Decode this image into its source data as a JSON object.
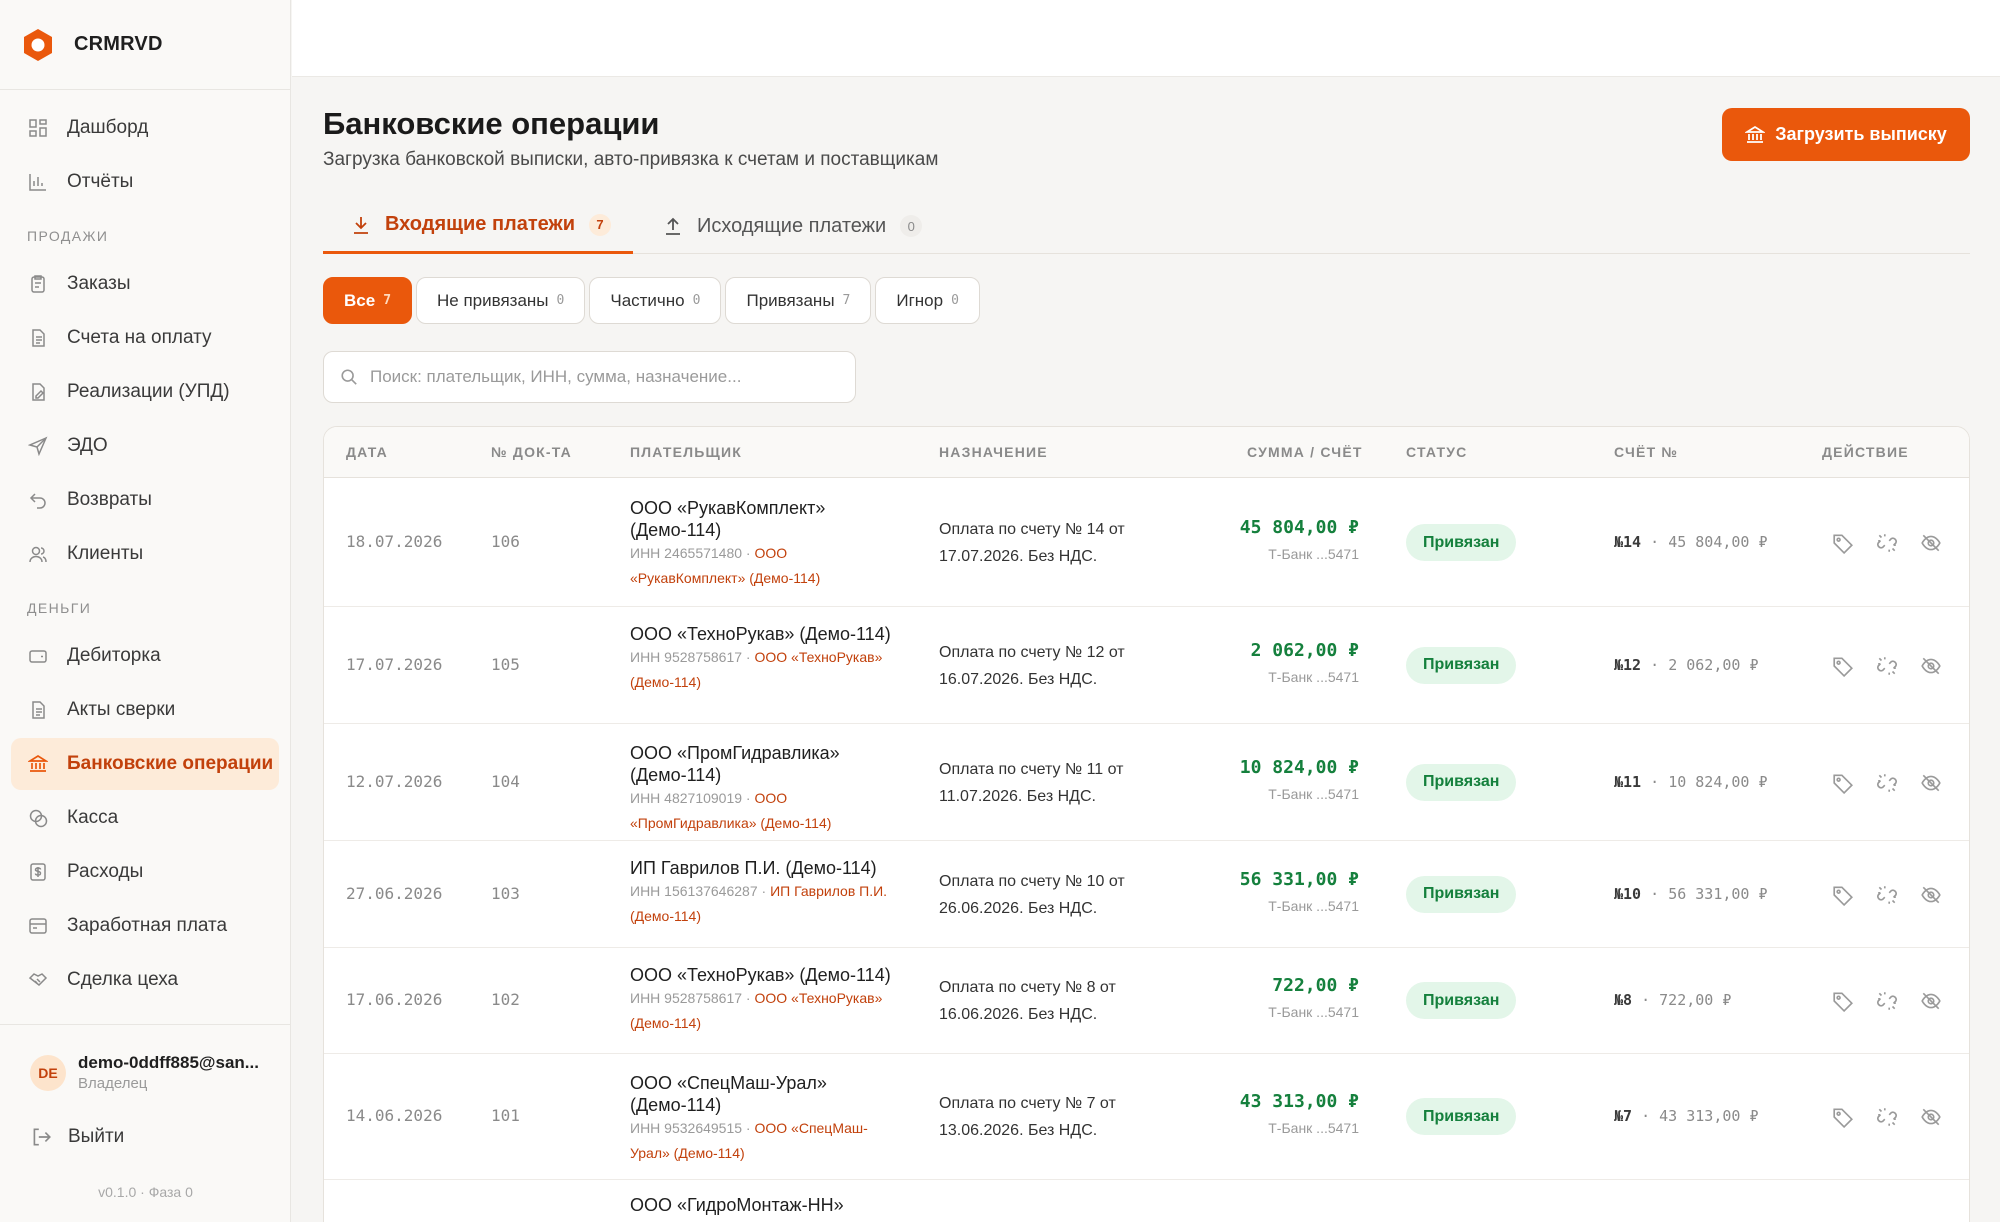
{
  "app": {
    "name": "CRMRVD",
    "version": "v0.1.0 · Фаза 0"
  },
  "sidebar": {
    "items_top": [
      {
        "label": "Дашборд",
        "icon": "dashboard-icon"
      },
      {
        "label": "Отчёты",
        "icon": "chart-icon"
      }
    ],
    "section_sales": "ПРОДАЖИ",
    "items_sales": [
      {
        "label": "Заказы",
        "icon": "clipboard-icon"
      },
      {
        "label": "Счета на оплату",
        "icon": "document-icon"
      },
      {
        "label": "Реализации (УПД)",
        "icon": "document-edit-icon"
      },
      {
        "label": "ЭДО",
        "icon": "send-icon"
      },
      {
        "label": "Возвраты",
        "icon": "return-icon"
      },
      {
        "label": "Клиенты",
        "icon": "users-icon"
      }
    ],
    "section_money": "ДЕНЬГИ",
    "items_money": [
      {
        "label": "Дебиторка",
        "icon": "wallet-icon"
      },
      {
        "label": "Акты сверки",
        "icon": "document-icon"
      },
      {
        "label": "Банковские операции",
        "icon": "bank-icon",
        "active": true
      },
      {
        "label": "Касса",
        "icon": "coins-icon"
      },
      {
        "label": "Расходы",
        "icon": "receipt-icon"
      },
      {
        "label": "Заработная плата",
        "icon": "payroll-icon"
      },
      {
        "label": "Сделка цеха",
        "icon": "handshake-icon"
      }
    ],
    "user": {
      "initials": "DE",
      "email": "demo-0ddff885@san...",
      "role": "Владелец"
    },
    "logout_label": "Выйти"
  },
  "page": {
    "title": "Банковские операции",
    "subtitle": "Загрузка банковской выписки, авто-привязка к счетам и поставщикам",
    "upload_button": "Загрузить выписку"
  },
  "tabs": [
    {
      "label": "Входящие платежи",
      "count": "7",
      "active": true
    },
    {
      "label": "Исходящие платежи",
      "count": "0",
      "active": false
    }
  ],
  "filters": [
    {
      "label": "Все",
      "count": "7",
      "active": true
    },
    {
      "label": "Не привязаны",
      "count": "0"
    },
    {
      "label": "Частично",
      "count": "0"
    },
    {
      "label": "Привязаны",
      "count": "7"
    },
    {
      "label": "Игнор",
      "count": "0"
    }
  ],
  "search": {
    "placeholder": "Поиск: плательщик, ИНН, сумма, назначение..."
  },
  "table": {
    "columns": [
      "ДАТА",
      "№ ДОК-ТА",
      "ПЛАТЕЛЬЩИК",
      "НАЗНАЧЕНИЕ",
      "СУММА / СЧЁТ",
      "СТАТУС",
      "СЧЁТ №",
      "ДЕЙСТВИЕ"
    ],
    "rows": [
      {
        "date": "18.07.2026",
        "doc": "106",
        "payer": "ООО «РукавКомплект» (Демо-114)",
        "inn": "ИНН 2465571480 ·",
        "link": "ООО «РукавКомплект» (Демо-114)",
        "purpose": "Оплата по счету № 14 от 17.07.2026. Без НДС.",
        "sum": "45 804,00 ₽",
        "account": "Т-Банк ...5471",
        "status": "Привязан",
        "inv_no": "№14",
        "inv_sum": "45 804,00 ₽"
      },
      {
        "date": "17.07.2026",
        "doc": "105",
        "payer": "ООО «ТехноРукав» (Демо-114)",
        "inn": "ИНН 9528758617 ·",
        "link": "ООО «ТехноРукав» (Демо-114)",
        "purpose": "Оплата по счету № 12 от 16.07.2026. Без НДС.",
        "sum": "2 062,00 ₽",
        "account": "Т-Банк ...5471",
        "status": "Привязан",
        "inv_no": "№12",
        "inv_sum": "2 062,00 ₽"
      },
      {
        "date": "12.07.2026",
        "doc": "104",
        "payer": "ООО «ПромГидравлика» (Демо-114)",
        "inn": "ИНН 4827109019 ·",
        "link": "ООО «ПромГидравлика» (Демо-114)",
        "purpose": "Оплата по счету № 11 от 11.07.2026. Без НДС.",
        "sum": "10 824,00 ₽",
        "account": "Т-Банк ...5471",
        "status": "Привязан",
        "inv_no": "№11",
        "inv_sum": "10 824,00 ₽"
      },
      {
        "date": "27.06.2026",
        "doc": "103",
        "payer": "ИП Гаврилов П.И. (Демо-114)",
        "inn": "ИНН 156137646287 ·",
        "link": "ИП Гаврилов П.И. (Демо-114)",
        "purpose": "Оплата по счету № 10 от 26.06.2026. Без НДС.",
        "sum": "56 331,00 ₽",
        "account": "Т-Банк ...5471",
        "status": "Привязан",
        "inv_no": "№10",
        "inv_sum": "56 331,00 ₽"
      },
      {
        "date": "17.06.2026",
        "doc": "102",
        "payer": "ООО «ТехноРукав» (Демо-114)",
        "inn": "ИНН 9528758617 ·",
        "link": "ООО «ТехноРукав» (Демо-114)",
        "purpose": "Оплата по счету № 8 от 16.06.2026. Без НДС.",
        "sum": "722,00 ₽",
        "account": "Т-Банк ...5471",
        "status": "Привязан",
        "inv_no": "№8",
        "inv_sum": "722,00 ₽"
      },
      {
        "date": "14.06.2026",
        "doc": "101",
        "payer": "ООО «СпецМаш-Урал» (Демо-114)",
        "inn": "ИНН 9532649515 ·",
        "link": "ООО «СпецМаш-Урал» (Демо-114)",
        "purpose": "Оплата по счету № 7 от 13.06.2026. Без НДС.",
        "sum": "43 313,00 ₽",
        "account": "Т-Банк ...5471",
        "status": "Привязан",
        "inv_no": "№7",
        "inv_sum": "43 313,00 ₽"
      },
      {
        "date": "",
        "doc": "",
        "payer": "ООО «ГидроМонтаж-НН»",
        "inn": "",
        "link": "",
        "purpose": "",
        "sum": "",
        "account": "",
        "status": "",
        "inv_no": "",
        "inv_sum": ""
      }
    ]
  }
}
